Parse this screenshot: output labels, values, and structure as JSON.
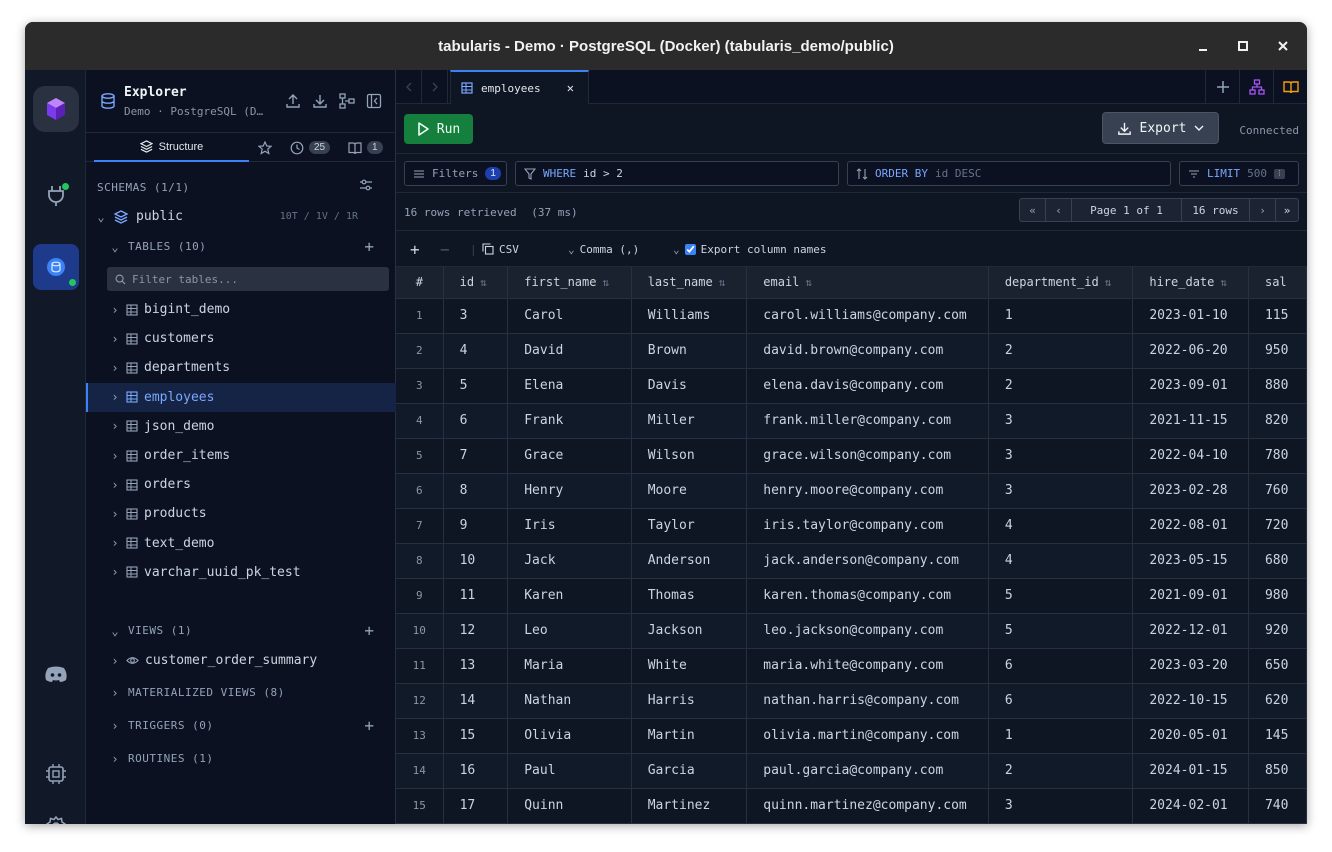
{
  "window": {
    "title": "tabularis - Demo · PostgreSQL (Docker) (tabularis_demo/public)",
    "controls": [
      "minimize",
      "maximize",
      "close"
    ]
  },
  "explorer": {
    "title": "Explorer",
    "subtitle": "Demo · PostgreSQL (D…",
    "tabs": {
      "structure": "Structure",
      "history_count": "25",
      "saved_count": "1"
    },
    "schemas_label": "SCHEMAS (1/1)",
    "schema": {
      "name": "public",
      "summary": "10T / 1V / 1R"
    },
    "tables_label": "TABLES (10)",
    "filter_placeholder": "Filter tables...",
    "tables": [
      {
        "name": "bigint_demo"
      },
      {
        "name": "customers"
      },
      {
        "name": "departments"
      },
      {
        "name": "employees",
        "selected": true
      },
      {
        "name": "json_demo"
      },
      {
        "name": "order_items"
      },
      {
        "name": "orders"
      },
      {
        "name": "products"
      },
      {
        "name": "text_demo"
      },
      {
        "name": "varchar_uuid_pk_test"
      }
    ],
    "views_label": "VIEWS (1)",
    "views": [
      {
        "name": "customer_order_summary"
      }
    ],
    "materialized_label": "MATERIALIZED VIEWS (8)",
    "triggers_label": "TRIGGERS (0)",
    "routines_label": "ROUTINES (1)"
  },
  "editor": {
    "tab_label": "employees",
    "run_label": "Run",
    "export_label": "Export",
    "status": "Connected"
  },
  "filters": {
    "filters_label": "Filters",
    "filters_count": "1",
    "where_kw": "WHERE",
    "where_value": "id > 2",
    "order_kw": "ORDER BY",
    "order_placeholder": "id DESC",
    "limit_kw": "LIMIT",
    "limit_value": "500"
  },
  "results": {
    "summary": "16 rows retrieved",
    "timing": "(37 ms)",
    "page_label": "Page 1 of 1",
    "rows_label": "16 rows"
  },
  "grid_tools": {
    "format": "CSV",
    "delimiter": "Comma (,)",
    "export_names_label": "Export column names",
    "export_names_checked": true
  },
  "grid": {
    "columns": [
      "#",
      "id",
      "first_name",
      "last_name",
      "email",
      "department_id",
      "hire_date",
      "sal"
    ],
    "rows": [
      [
        "1",
        "3",
        "Carol",
        "Williams",
        "carol.williams@company.com",
        "1",
        "2023-01-10",
        "115"
      ],
      [
        "2",
        "4",
        "David",
        "Brown",
        "david.brown@company.com",
        "2",
        "2022-06-20",
        "950"
      ],
      [
        "3",
        "5",
        "Elena",
        "Davis",
        "elena.davis@company.com",
        "2",
        "2023-09-01",
        "880"
      ],
      [
        "4",
        "6",
        "Frank",
        "Miller",
        "frank.miller@company.com",
        "3",
        "2021-11-15",
        "820"
      ],
      [
        "5",
        "7",
        "Grace",
        "Wilson",
        "grace.wilson@company.com",
        "3",
        "2022-04-10",
        "780"
      ],
      [
        "6",
        "8",
        "Henry",
        "Moore",
        "henry.moore@company.com",
        "3",
        "2023-02-28",
        "760"
      ],
      [
        "7",
        "9",
        "Iris",
        "Taylor",
        "iris.taylor@company.com",
        "4",
        "2022-08-01",
        "720"
      ],
      [
        "8",
        "10",
        "Jack",
        "Anderson",
        "jack.anderson@company.com",
        "4",
        "2023-05-15",
        "680"
      ],
      [
        "9",
        "11",
        "Karen",
        "Thomas",
        "karen.thomas@company.com",
        "5",
        "2021-09-01",
        "980"
      ],
      [
        "10",
        "12",
        "Leo",
        "Jackson",
        "leo.jackson@company.com",
        "5",
        "2022-12-01",
        "920"
      ],
      [
        "11",
        "13",
        "Maria",
        "White",
        "maria.white@company.com",
        "6",
        "2023-03-20",
        "650"
      ],
      [
        "12",
        "14",
        "Nathan",
        "Harris",
        "nathan.harris@company.com",
        "6",
        "2022-10-15",
        "620"
      ],
      [
        "13",
        "15",
        "Olivia",
        "Martin",
        "olivia.martin@company.com",
        "1",
        "2020-05-01",
        "145"
      ],
      [
        "14",
        "16",
        "Paul",
        "Garcia",
        "paul.garcia@company.com",
        "2",
        "2024-01-15",
        "850"
      ],
      [
        "15",
        "17",
        "Quinn",
        "Martinez",
        "quinn.martinez@company.com",
        "3",
        "2024-02-01",
        "740"
      ]
    ]
  },
  "colors": {
    "accent": "#3b82f6",
    "run_green": "#15803d",
    "status_dot": "#22c55e",
    "diagram_purple": "#a855f7",
    "notebook_orange": "#f59e0b"
  },
  "icons": {
    "rail": [
      "app-logo-icon",
      "plug-icon",
      "database-connection-icon",
      "discord-icon",
      "cpu-icon",
      "gear-icon"
    ]
  }
}
